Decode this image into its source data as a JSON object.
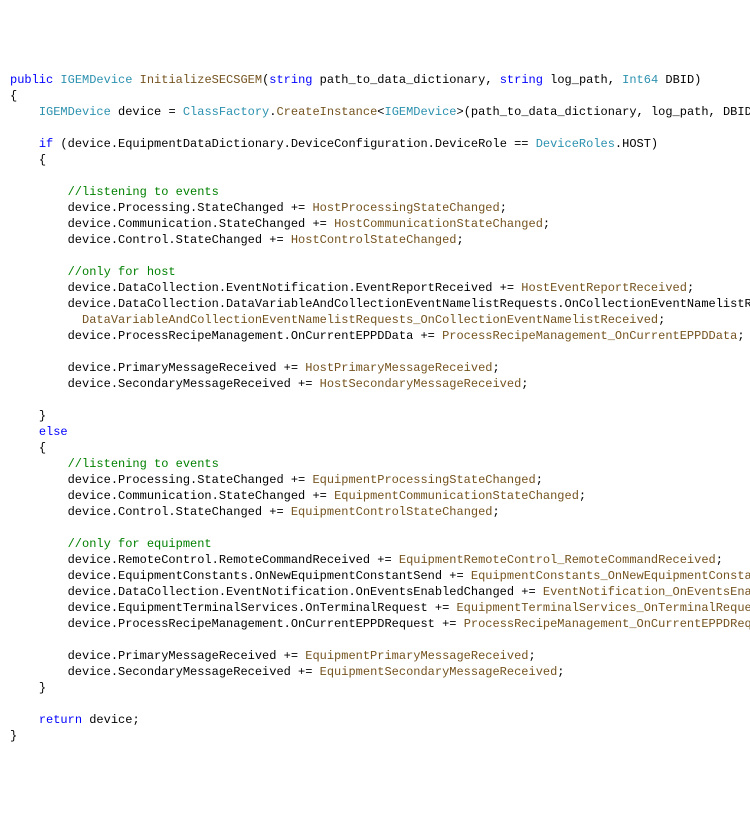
{
  "code": {
    "l01": {
      "kw1": "public",
      "t1": " IGEMDevice",
      "m1": " InitializeSECSGEM",
      "p1": "(",
      "kw2": "string",
      "p2": " path_to_data_dictionary, ",
      "kw3": "string",
      "p3": " log_path, ",
      "t2": "Int64",
      "p4": " DBID)"
    },
    "l02": {
      "p": "{"
    },
    "l03": {
      "i": "    ",
      "t1": "IGEMDevice",
      "p1": " device = ",
      "t2": "ClassFactory",
      "p2": ".",
      "m1": "CreateInstance",
      "p3": "<",
      "t3": "IGEMDevice",
      "p4": ">(path_to_data_dictionary, log_path, DBID);"
    },
    "l04": {
      "p": ""
    },
    "l05": {
      "i": "    ",
      "kw": "if",
      "p1": " (device.EquipmentDataDictionary.DeviceConfiguration.DeviceRole == ",
      "t": "DeviceRoles",
      "p2": ".HOST)"
    },
    "l06": {
      "i": "    ",
      "p": "{"
    },
    "l07": {
      "p": ""
    },
    "l08": {
      "i": "        ",
      "c": "//listening to events"
    },
    "l09": {
      "i": "        ",
      "p1": "device.Processing.StateChanged += ",
      "m": "HostProcessingStateChanged",
      "p2": ";"
    },
    "l10": {
      "i": "        ",
      "p1": "device.Communication.StateChanged += ",
      "m": "HostCommunicationStateChanged",
      "p2": ";"
    },
    "l11": {
      "i": "        ",
      "p1": "device.Control.StateChanged += ",
      "m": "HostControlStateChanged",
      "p2": ";"
    },
    "l12": {
      "p": ""
    },
    "l13": {
      "i": "        ",
      "c": "//only for host"
    },
    "l14": {
      "i": "        ",
      "p1": "device.DataCollection.EventNotification.EventReportReceived += ",
      "m": "HostEventReportReceived",
      "p2": ";"
    },
    "l15": {
      "i": "        ",
      "p1": "device.DataCollection.DataVariableAndCollectionEventNamelistRequests.OnCollectionEventNamelistReceived +="
    },
    "l16": {
      "i": "          ",
      "m": "DataVariableAndCollectionEventNamelistRequests_OnCollectionEventNamelistReceived",
      "p": ";"
    },
    "l17": {
      "i": "        ",
      "p1": "device.ProcessRecipeManagement.OnCurrentEPPDData += ",
      "m": "ProcessRecipeManagement_OnCurrentEPPDData",
      "p2": ";"
    },
    "l18": {
      "p": ""
    },
    "l19": {
      "i": "        ",
      "p1": "device.PrimaryMessageReceived += ",
      "m": "HostPrimaryMessageReceived",
      "p2": ";"
    },
    "l20": {
      "i": "        ",
      "p1": "device.SecondaryMessageReceived += ",
      "m": "HostSecondaryMessageReceived",
      "p2": ";"
    },
    "l21": {
      "p": ""
    },
    "l22": {
      "i": "    ",
      "p": "}"
    },
    "l23": {
      "i": "    ",
      "kw": "else"
    },
    "l24": {
      "i": "    ",
      "p": "{"
    },
    "l25": {
      "i": "        ",
      "c": "//listening to events"
    },
    "l26": {
      "i": "        ",
      "p1": "device.Processing.StateChanged += ",
      "m": "EquipmentProcessingStateChanged",
      "p2": ";"
    },
    "l27": {
      "i": "        ",
      "p1": "device.Communication.StateChanged += ",
      "m": "EquipmentCommunicationStateChanged",
      "p2": ";"
    },
    "l28": {
      "i": "        ",
      "p1": "device.Control.StateChanged += ",
      "m": "EquipmentControlStateChanged",
      "p2": ";"
    },
    "l29": {
      "p": ""
    },
    "l30": {
      "i": "        ",
      "c": "//only for equipment"
    },
    "l31": {
      "i": "        ",
      "p1": "device.RemoteControl.RemoteCommandReceived += ",
      "m": "EquipmentRemoteControl_RemoteCommandReceived",
      "p2": ";"
    },
    "l32": {
      "i": "        ",
      "p1": "device.EquipmentConstants.OnNewEquipmentConstantSend += ",
      "m": "EquipmentConstants_OnNewEquipmentConstantSend",
      "p2": ";"
    },
    "l33": {
      "i": "        ",
      "p1": "device.DataCollection.EventNotification.OnEventsEnabledChanged += ",
      "m": "EventNotification_OnEventsEnabledChanged",
      "p2": ";"
    },
    "l34": {
      "i": "        ",
      "p1": "device.EquipmentTerminalServices.OnTerminalRequest += ",
      "m": "EquipmentTerminalServices_OnTerminalRequest",
      "p2": ";"
    },
    "l35": {
      "i": "        ",
      "p1": "device.ProcessRecipeManagement.OnCurrentEPPDRequest += ",
      "m": "ProcessRecipeManagement_OnCurrentEPPDRequest",
      "p2": ";"
    },
    "l36": {
      "p": ""
    },
    "l37": {
      "i": "        ",
      "p1": "device.PrimaryMessageReceived += ",
      "m": "EquipmentPrimaryMessageReceived",
      "p2": ";"
    },
    "l38": {
      "i": "        ",
      "p1": "device.SecondaryMessageReceived += ",
      "m": "EquipmentSecondaryMessageReceived",
      "p2": ";"
    },
    "l39": {
      "i": "    ",
      "p": "}"
    },
    "l40": {
      "p": ""
    },
    "l41": {
      "i": "    ",
      "kw": "return",
      "p": " device;"
    },
    "l42": {
      "p": "}"
    }
  }
}
